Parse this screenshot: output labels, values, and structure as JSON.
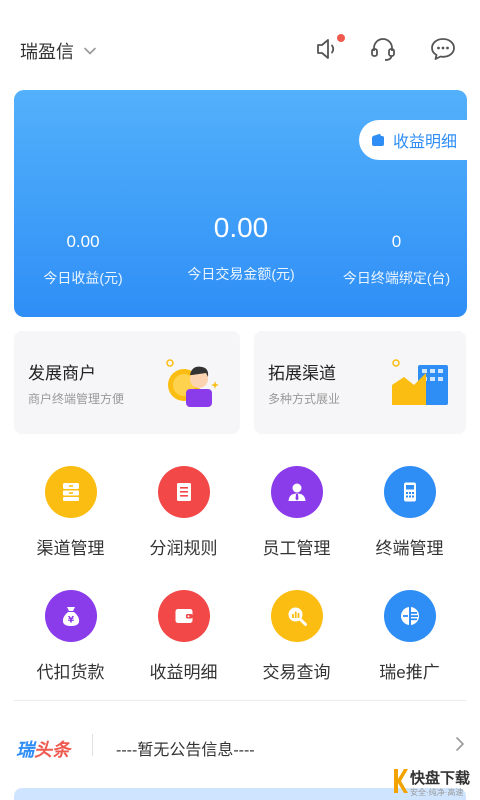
{
  "header": {
    "org_name": "瑞盈信",
    "icons": [
      "chevron-down-icon",
      "speaker-icon",
      "headset-icon",
      "chat-icon"
    ],
    "notification_dot_color": "#ef5a4f"
  },
  "summary_card": {
    "income_button": "收益明细",
    "stats": [
      {
        "value": "0.00",
        "label": "今日收益(元)"
      },
      {
        "value": "0.00",
        "label": "今日交易金额(元)"
      },
      {
        "value": "0",
        "label": "今日终端绑定(台)"
      }
    ],
    "accent": "#2f8ef6"
  },
  "promos": [
    {
      "title": "发展商户",
      "subtitle": "商户终端管理方便"
    },
    {
      "title": "拓展渠道",
      "subtitle": "多种方式展业"
    }
  ],
  "menu": [
    {
      "label": "渠道管理",
      "icon": "drawer-icon",
      "color": "#fbbd12"
    },
    {
      "label": "分润规则",
      "icon": "document-icon",
      "color": "#f24848"
    },
    {
      "label": "员工管理",
      "icon": "employee-icon",
      "color": "#8a3bea"
    },
    {
      "label": "终端管理",
      "icon": "pos-terminal-icon",
      "color": "#2f8ef6"
    },
    {
      "label": "代扣货款",
      "icon": "money-bag-icon",
      "color": "#8a3bea"
    },
    {
      "label": "收益明细",
      "icon": "wallet-icon",
      "color": "#f24848"
    },
    {
      "label": "交易查询",
      "icon": "search-chart-icon",
      "color": "#fbbd12"
    },
    {
      "label": "瑞e推广",
      "icon": "promotion-icon",
      "color": "#2f8ef6"
    }
  ],
  "news": {
    "brand_a": "瑞",
    "brand_b": "头条",
    "text": "----暂无公告信息----"
  },
  "watermark": {
    "title": "快盘下载",
    "subtitle": "安全·纯净·高速"
  }
}
